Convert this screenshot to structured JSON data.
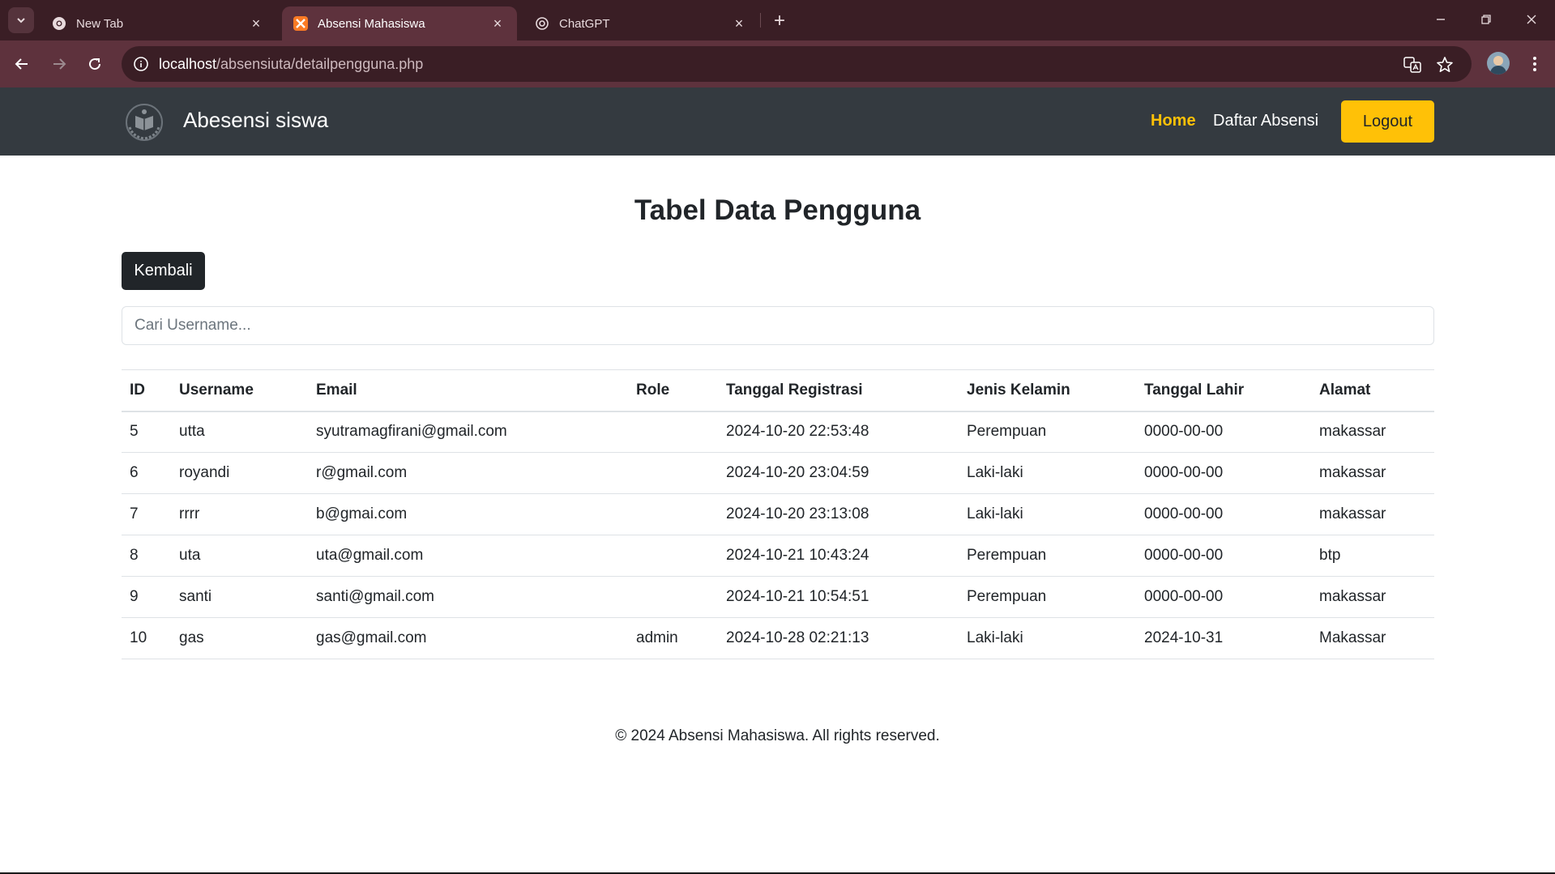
{
  "browser": {
    "tabs": [
      {
        "title": "New Tab",
        "icon": "chrome-icon",
        "active": false
      },
      {
        "title": "Absensi Mahasiswa",
        "icon": "xampp-icon",
        "active": true
      },
      {
        "title": "ChatGPT",
        "icon": "openai-icon",
        "active": false
      }
    ],
    "url_host": "localhost",
    "url_path": "/absensiuta/detailpengguna.php"
  },
  "navbar": {
    "brand": "Abesensi siswa",
    "links": [
      {
        "label": "Home",
        "active": true
      },
      {
        "label": "Daftar Absensi",
        "active": false
      }
    ],
    "logout_label": "Logout"
  },
  "main": {
    "title": "Tabel Data Pengguna",
    "back_label": "Kembali",
    "search_placeholder": "Cari Username...",
    "table": {
      "headers": {
        "id": "ID",
        "username": "Username",
        "email": "Email",
        "role": "Role",
        "registrasi": "Tanggal Registrasi",
        "jenis_kelamin": "Jenis Kelamin",
        "tanggal_lahir": "Tanggal Lahir",
        "alamat": "Alamat"
      },
      "rows": [
        {
          "id": "5",
          "username": "utta",
          "email": "syutramagfirani@gmail.com",
          "role": "",
          "registrasi": "2024-10-20 22:53:48",
          "jenis_kelamin": "Perempuan",
          "tanggal_lahir": "0000-00-00",
          "alamat": "makassar"
        },
        {
          "id": "6",
          "username": "royandi",
          "email": "r@gmail.com",
          "role": "",
          "registrasi": "2024-10-20 23:04:59",
          "jenis_kelamin": "Laki-laki",
          "tanggal_lahir": "0000-00-00",
          "alamat": "makassar"
        },
        {
          "id": "7",
          "username": "rrrr",
          "email": "b@gmai.com",
          "role": "",
          "registrasi": "2024-10-20 23:13:08",
          "jenis_kelamin": "Laki-laki",
          "tanggal_lahir": "0000-00-00",
          "alamat": "makassar"
        },
        {
          "id": "8",
          "username": "uta",
          "email": "uta@gmail.com",
          "role": "",
          "registrasi": "2024-10-21 10:43:24",
          "jenis_kelamin": "Perempuan",
          "tanggal_lahir": "0000-00-00",
          "alamat": "btp"
        },
        {
          "id": "9",
          "username": "santi",
          "email": "santi@gmail.com",
          "role": "",
          "registrasi": "2024-10-21 10:54:51",
          "jenis_kelamin": "Perempuan",
          "tanggal_lahir": "0000-00-00",
          "alamat": "makassar"
        },
        {
          "id": "10",
          "username": "gas",
          "email": "gas@gmail.com",
          "role": "admin",
          "registrasi": "2024-10-28 02:21:13",
          "jenis_kelamin": "Laki-laki",
          "tanggal_lahir": "2024-10-31",
          "alamat": "Makassar"
        }
      ]
    }
  },
  "footer": {
    "text": "© 2024 Absensi Mahasiswa. All rights reserved."
  },
  "colors": {
    "navbar_bg": "#343a40",
    "accent": "#ffc107",
    "dark_button": "#212529",
    "browser_frame": "#3a1e25"
  }
}
